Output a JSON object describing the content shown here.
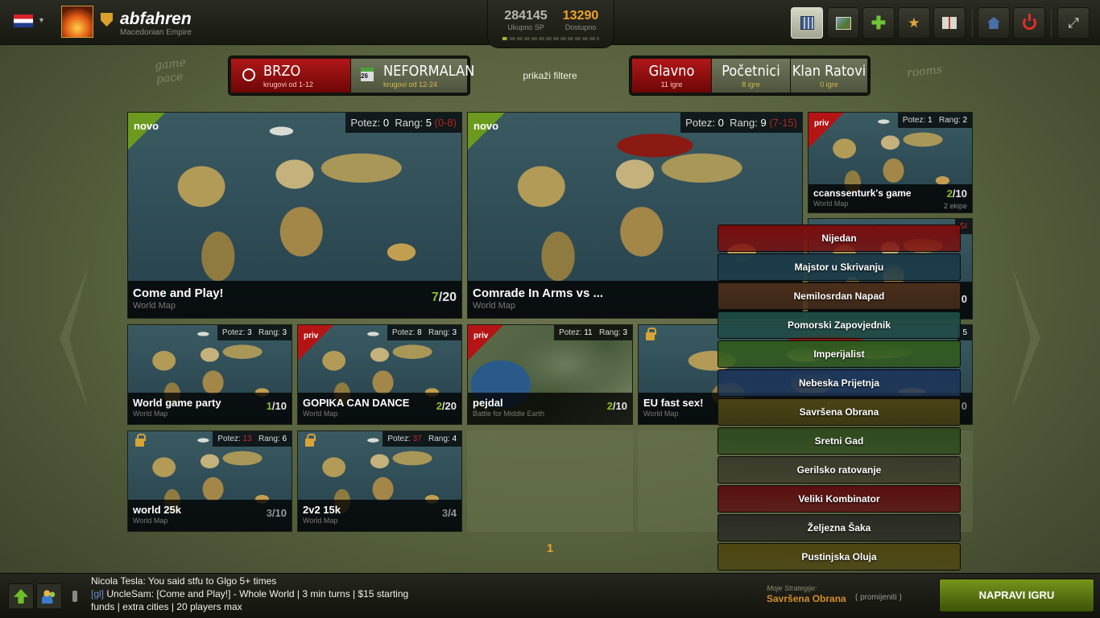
{
  "header": {
    "username": "abfahren",
    "empire": "Macedonian Empire",
    "stats": {
      "total_value": "284145",
      "total_label": "Ukupno SP",
      "available_value": "13290",
      "available_label": "Dostupno",
      "progress": 0.04
    }
  },
  "toolbar": {
    "icons": [
      "city-icon",
      "map-icon",
      "plus-icon",
      "medal-icon",
      "book-icon",
      "home-icon",
      "power-icon",
      "fullscreen-icon"
    ]
  },
  "hints": {
    "game_pace": "game\npace",
    "rooms": "rooms"
  },
  "pace": {
    "fast": {
      "label": "BRZO",
      "sub": "krugovi od 1-12"
    },
    "slow": {
      "label": "NEFORMALAN",
      "sub": "krugovi od 12-24",
      "day": "26"
    }
  },
  "filters_link": "prikaži filtere",
  "rooms": [
    {
      "label": "Glavno",
      "sub": "11 igre"
    },
    {
      "label": "Početnici",
      "sub": "8 igre"
    },
    {
      "label": "Klan Ratovi",
      "sub": "0 igre"
    }
  ],
  "games": [
    {
      "title": "Come and Play!",
      "map": "World Map",
      "badge": "novo",
      "potez_label": "Potez:",
      "potez": "0",
      "rang_label": "Rang:",
      "rang": "5",
      "range": "(0-8)",
      "cur": "7",
      "max": "/20"
    },
    {
      "title": "Comrade In Arms vs ...",
      "map": "World Map",
      "badge": "novo",
      "potez_label": "Potez:",
      "potez": "0",
      "rang_label": "Rang:",
      "rang": "9",
      "range": "(7-15)"
    },
    {
      "title": "ccanssenturk's game",
      "map": "World Map",
      "badge": "priv",
      "potez_label": "Potez:",
      "potez": "1",
      "rang_label": "Rang:",
      "rang": "2",
      "cur": "2",
      "max": "/10",
      "teams": "2 ekipe"
    },
    {
      "title": "World game party",
      "map": "World Map",
      "potez_label": "Potez:",
      "potez": "3",
      "rang_label": "Rang:",
      "rang": "3",
      "cur": "1",
      "max": "/10"
    },
    {
      "title": "GOPIKA CAN DANCE",
      "map": "World Map",
      "badge": "priv",
      "potez_label": "Potez:",
      "potez": "8",
      "rang_label": "Rang:",
      "rang": "3",
      "cur": "2",
      "max": "/20"
    },
    {
      "title": "pejdal",
      "map": "Battle for Middle Earth",
      "badge": "priv",
      "potez_label": "Potez:",
      "potez": "11",
      "rang_label": "Rang:",
      "rang": "3",
      "cur": "2",
      "max": "/10"
    },
    {
      "title": "EU fast sex!",
      "map": "World Map"
    },
    {
      "title": "world 25k",
      "map": "World Map",
      "potez_label": "Potez:",
      "potez": "13",
      "rang_label": "Rang:",
      "rang": "6",
      "cur": "3",
      "max": "/10"
    },
    {
      "title": "2v2 15k",
      "map": "World Map",
      "potez_label": "Potez:",
      "potez": "37",
      "rang_label": "Rang:",
      "rang": "4",
      "cur": "3",
      "max": "/4"
    }
  ],
  "partial": {
    "p1": "SI",
    "p2": "0",
    "p3": "5",
    "p4": "0"
  },
  "page": "1",
  "strategies": [
    {
      "label": "Nijedan",
      "color": "#7a0d0d"
    },
    {
      "label": "Majstor u Skrivanju",
      "color": "#1b3a48"
    },
    {
      "label": "Nemilosrdan Napad",
      "color": "#4a2e1a"
    },
    {
      "label": "Pomorski Zapovjednik",
      "color": "#1e4a44"
    },
    {
      "label": "Imperijalist",
      "color": "#2f5a1e"
    },
    {
      "label": "Nebeska Prijetnja",
      "color": "#1d3558"
    },
    {
      "label": "Savršena Obrana",
      "color": "#4a4314"
    },
    {
      "label": "Sretni Gad",
      "color": "#2e4a1e"
    },
    {
      "label": "Gerilsko ratovanje",
      "color": "#3a3a2a"
    },
    {
      "label": "Veliki Kombinator",
      "color": "#5a0f0f"
    },
    {
      "label": "Željezna Šaka",
      "color": "#2a2a24"
    },
    {
      "label": "Pustinjska Oluja",
      "color": "#4e4612"
    }
  ],
  "chat": {
    "line1": "Nicola Tesla: You said stfu to Glgo 5+ times",
    "line2_channel": "[gl]",
    "line2_text": " UncleSam: [Come and Play!] - Whole World | 3 min turns | $15 starting",
    "line3": "funds | extra cities | 20 players max"
  },
  "my_strategy": {
    "label": "Moje Strategije:",
    "value": "Savršena Obrana",
    "change": "( promijeniti )"
  },
  "create_button": "NAPRAVI IGRU"
}
